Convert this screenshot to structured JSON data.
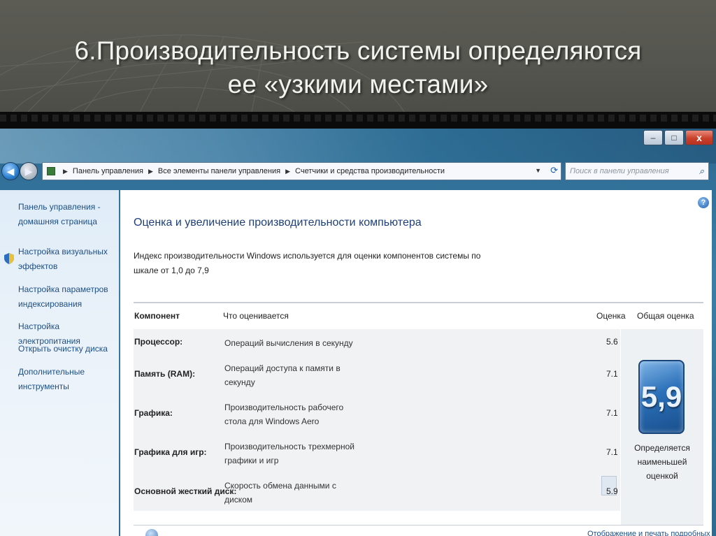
{
  "slide": {
    "title_line1": "6.Производительность системы определяются",
    "title_line2": "ее «узкими местами»"
  },
  "window": {
    "controls": {
      "minimize": "–",
      "maximize": "□",
      "close": "x"
    }
  },
  "nav": {
    "breadcrumb": [
      "Панель управления",
      "Все элементы панели управления",
      "Счетчики и средства производительности"
    ],
    "search_placeholder": "Поиск в панели управления"
  },
  "sidebar": {
    "items": [
      {
        "label": "Панель управления - домашняя страница"
      },
      {
        "label": "Настройка визуальных эффектов"
      },
      {
        "label": "Настройка параметров индексирования"
      },
      {
        "label": "Настройка электропитания"
      },
      {
        "label": "Открыть очистку диска"
      },
      {
        "label": "Дополнительные инструменты"
      }
    ]
  },
  "main": {
    "title": "Оценка и увеличение производительности компьютера",
    "description": "Индекс производительности Windows используется для оценки компонентов системы по шкале от 1,0 до 7,9",
    "table": {
      "headers": {
        "component": "Компонент",
        "what": "Что оценивается",
        "score": "Оценка",
        "overall": "Общая оценка"
      },
      "rows": [
        {
          "component": "Процессор:",
          "what": "Операций вычисления в секунду",
          "score": "5.6"
        },
        {
          "component": "Память (RAM):",
          "what": "Операций доступа к памяти в секунду",
          "score": "7.1"
        },
        {
          "component": "Графика:",
          "what": "Производительность рабочего стола для Windows Aero",
          "score": "7.1"
        },
        {
          "component": "Графика для игр:",
          "what": "Производительность трехмерной графики и игр",
          "score": "7.1"
        },
        {
          "component": "Основной жесткий диск:",
          "what": "Скорость обмена данными с диском",
          "score": "5.9"
        }
      ],
      "overall_value": "5,9",
      "overall_note": "Определяется наименьшей оценкой"
    },
    "print_link": "Отображение и печать подробных"
  }
}
